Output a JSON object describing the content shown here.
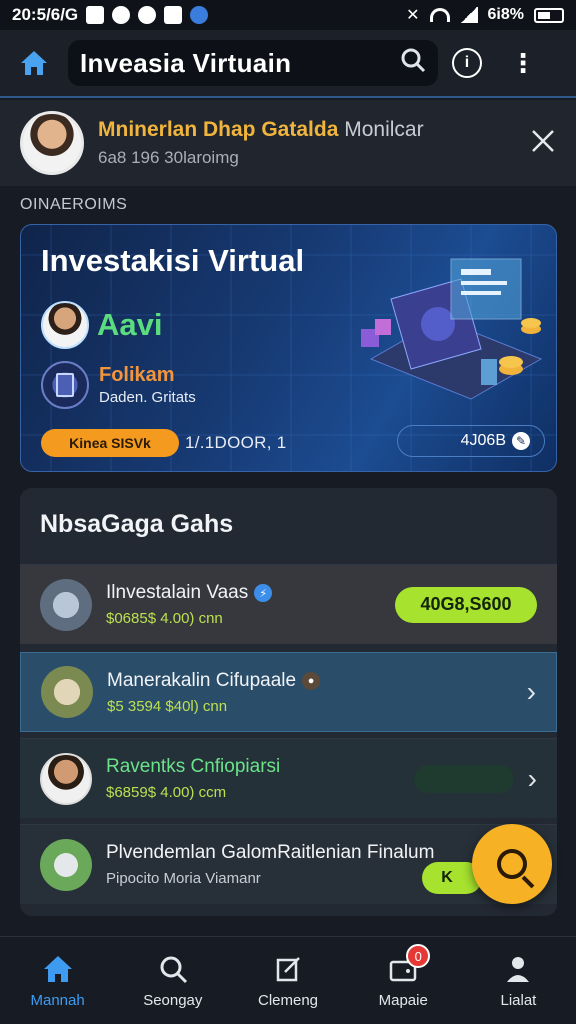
{
  "status_bar": {
    "time": "20:5/6/G",
    "battery": "6i8%"
  },
  "app_bar": {
    "title": "Inveasia Virtuain",
    "info_label": "i"
  },
  "notice": {
    "highlight": "Mninerlan Dhap Gatalda",
    "rest": "Monilcar",
    "subtitle": "6a8 196 30laroimg"
  },
  "section_label": "OINAEROIMS",
  "hero": {
    "title": "Investakisi Virtual",
    "user_name": "Aavi",
    "app_name": "Folikam",
    "app_sub": "Daden. Gritats",
    "pill": "Kinea SISVk",
    "mid_text": "1/.1DOOR,    1",
    "value": "4J06B"
  },
  "panel": {
    "title": "NbsaGaga Gahs",
    "rows": [
      {
        "title": "Ilnvestalain Vaas",
        "subtitle": "$0685$ 4.00) cnn",
        "value": "40G8,S600"
      },
      {
        "title": "Manerakalin Cifupaale",
        "subtitle": "$5 3594 $40l) cnn"
      },
      {
        "title": "Raventks Cnfiopiarsi",
        "subtitle": "$6859$ 4.00) ccm"
      },
      {
        "title": "Plvendemlan GalomRaitlenian Finalum",
        "subtitle": "Pipocito Moria Viamanr",
        "pill": "K"
      }
    ]
  },
  "bottom_nav": [
    {
      "label": "Mannah",
      "icon": "home-icon"
    },
    {
      "label": "Seongay",
      "icon": "search-icon"
    },
    {
      "label": "Clemeng",
      "icon": "edit-icon"
    },
    {
      "label": "Mapaie",
      "icon": "wallet-icon",
      "badge": "0"
    },
    {
      "label": "Lialat",
      "icon": "profile-icon"
    }
  ],
  "colors": {
    "accent": "#3e9bf0",
    "highlight": "#f1b53d",
    "green": "#a6e22e",
    "fab": "#f7b124"
  }
}
